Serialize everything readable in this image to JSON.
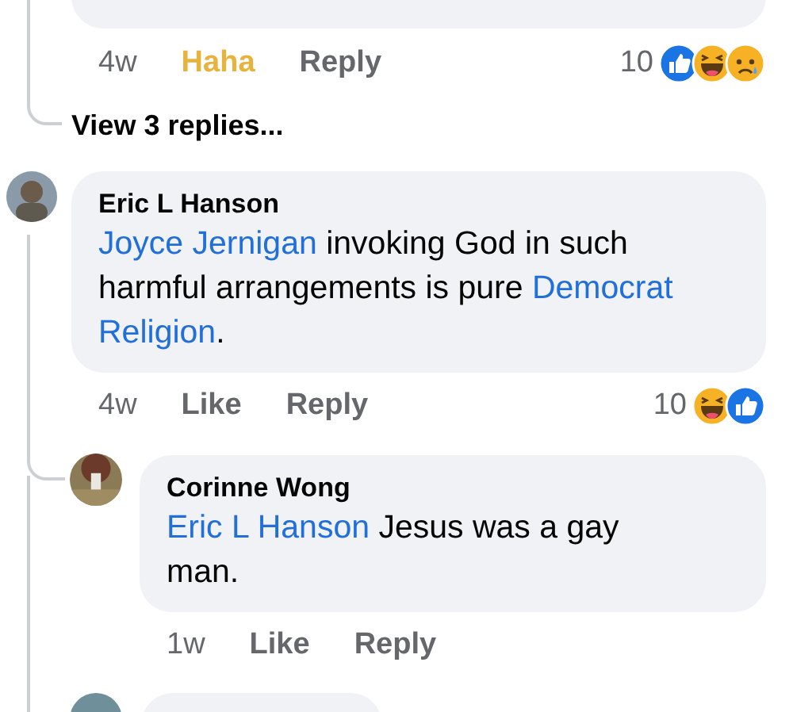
{
  "previous_comment": {
    "actions": [
      {
        "kind": "time",
        "label": "4w"
      },
      {
        "kind": "react",
        "label": "Haha",
        "selected": true
      },
      {
        "kind": "reply",
        "label": "Reply"
      }
    ],
    "reaction_count": "10",
    "reactions": [
      {
        "kind": "like"
      },
      {
        "kind": "haha"
      },
      {
        "kind": "sad"
      }
    ],
    "view_replies": "View 3 replies..."
  },
  "comments": [
    {
      "author": "Eric L Hanson",
      "text": [
        {
          "kind": "mention",
          "text": "Joyce Jernigan"
        },
        {
          "kind": "plain",
          "text": " invoking God in such harmful arrangements is pure "
        },
        {
          "kind": "mention",
          "text": "Democrat "
        },
        {
          "kind": "mention",
          "text": "Religion"
        },
        {
          "kind": "plain",
          "text": "."
        }
      ],
      "actions": [
        {
          "kind": "time",
          "label": "4w"
        },
        {
          "kind": "react",
          "label": "Like",
          "selected": false
        },
        {
          "kind": "reply",
          "label": "Reply"
        }
      ],
      "reaction_count": "10",
      "reactions": [
        {
          "kind": "haha"
        },
        {
          "kind": "like"
        }
      ]
    },
    {
      "author": "Corinne Wong",
      "text": [
        {
          "kind": "mention",
          "text": "Eric L Hanson"
        },
        {
          "kind": "plain",
          "text": " Jesus was a gay man."
        }
      ],
      "actions": [
        {
          "kind": "time",
          "label": "1w"
        },
        {
          "kind": "react",
          "label": "Like",
          "selected": false
        },
        {
          "kind": "reply",
          "label": "Reply"
        }
      ]
    }
  ]
}
